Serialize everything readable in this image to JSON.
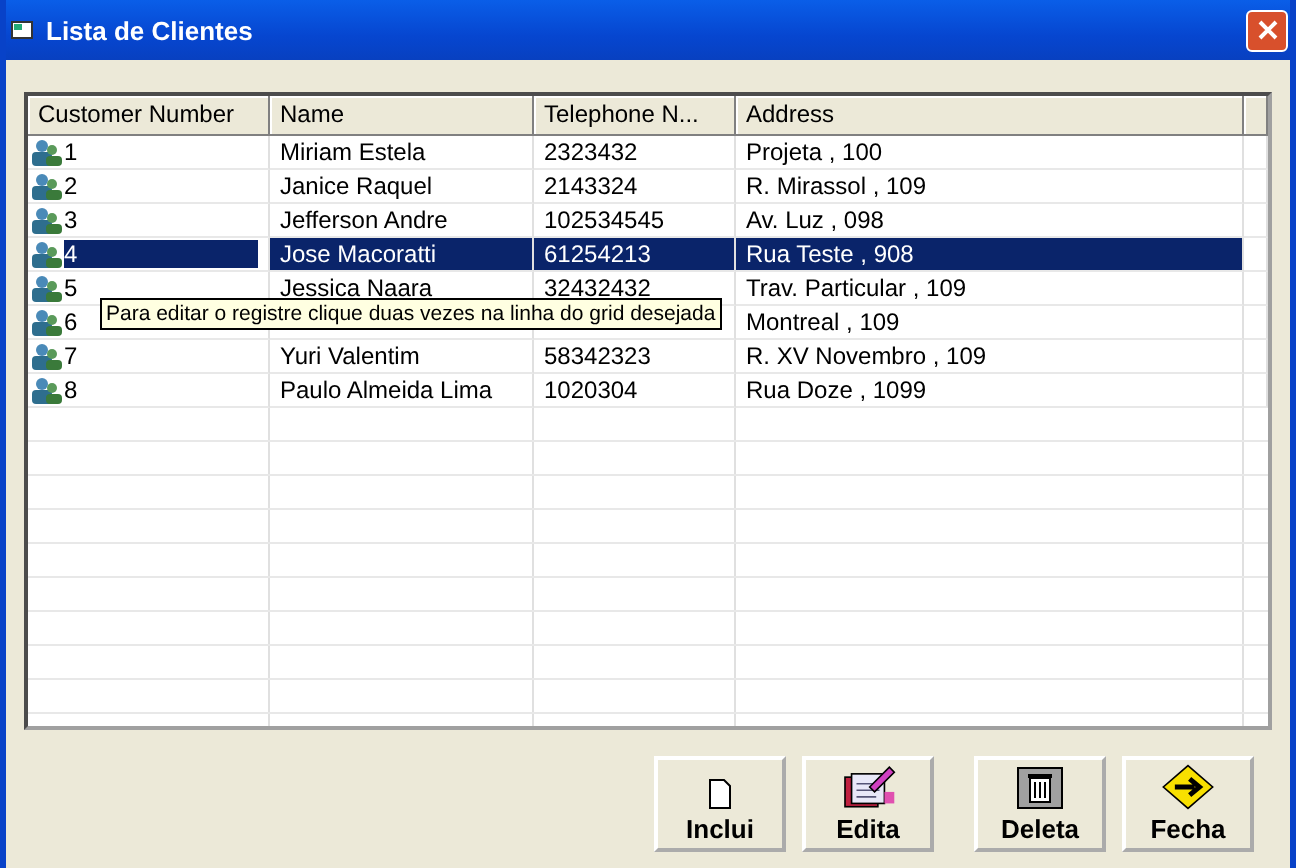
{
  "window": {
    "title": "Lista de Clientes"
  },
  "grid": {
    "columns": [
      "Customer Number",
      "Name",
      "Telephone N...",
      "Address"
    ],
    "rows": [
      {
        "number": "1",
        "name": "Miriam Estela",
        "phone": "2323432",
        "address": "Projeta , 100",
        "selected": false
      },
      {
        "number": "2",
        "name": "Janice Raquel",
        "phone": "2143324",
        "address": "R. Mirassol , 109",
        "selected": false
      },
      {
        "number": "3",
        "name": "Jefferson Andre",
        "phone": "102534545",
        "address": "Av. Luz , 098",
        "selected": false
      },
      {
        "number": "4",
        "name": "Jose Macoratti",
        "phone": "61254213",
        "address": "Rua Teste , 908",
        "selected": true
      },
      {
        "number": "5",
        "name": "Jessica Naara",
        "phone": "32432432",
        "address": "Trav. Particular , 109",
        "selected": false
      },
      {
        "number": "6",
        "address": "Montreal , 109",
        "selected": false
      },
      {
        "number": "7",
        "name": "Yuri Valentim",
        "phone": "58342323",
        "address": "R. XV Novembro , 109",
        "selected": false
      },
      {
        "number": "8",
        "name": "Paulo Almeida Lima",
        "phone": "1020304",
        "address": "Rua Doze , 1099",
        "selected": false
      }
    ]
  },
  "tooltip": "Para editar o registre clique duas vezes na linha do grid desejada",
  "buttons": [
    {
      "label": "Inclui",
      "kind": "new"
    },
    {
      "label": "Edita",
      "kind": "edit"
    },
    {
      "label": "Deleta",
      "kind": "delete"
    },
    {
      "label": "Fecha",
      "kind": "close"
    }
  ]
}
